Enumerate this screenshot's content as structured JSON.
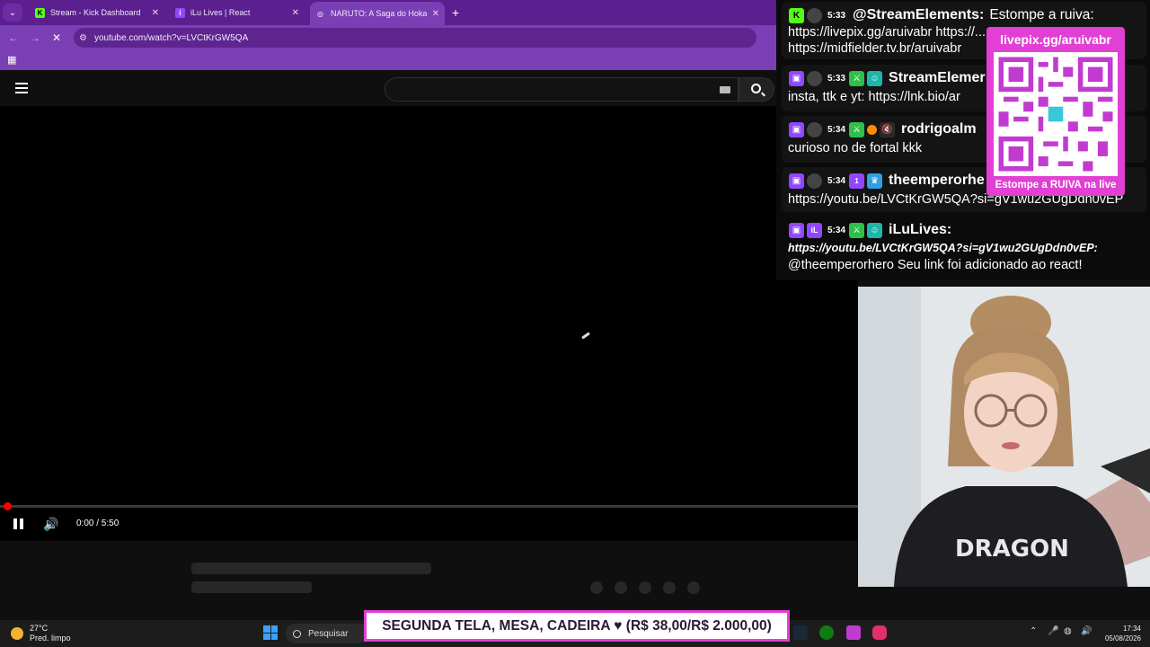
{
  "browser": {
    "tabs": [
      {
        "label": "Stream - Kick Dashboard",
        "favicon": "K",
        "color": "#53fc18"
      },
      {
        "label": "iLu Lives | React",
        "favicon": "i",
        "color": "#9146ff"
      },
      {
        "label": "NARUTO: A Saga do Hokage (I",
        "favicon": "◎",
        "color": "#ffffff"
      }
    ],
    "url": "youtube.com/watch?v=LVCtKrGW5QA"
  },
  "player": {
    "time": "0:00 / 5:50",
    "progress_fraction": 0
  },
  "chat": {
    "messages": [
      {
        "time": "5:33",
        "name": "@StreamElements:",
        "text_inline": "Estompe a ruiva:",
        "line2": "https://livepix.gg/aruivabr https://...",
        "line3": "https://midfielder.tv.br/aruivabr"
      },
      {
        "time": "5:33",
        "name": "StreamElemer",
        "text": "insta, ttk e yt: https://lnk.bio/ar"
      },
      {
        "time": "5:34",
        "name": "rodrigoalm",
        "text": "curioso no de fortal kkk"
      },
      {
        "time": "5:34",
        "name": "theemperorhe",
        "text": "https://youtu.be/LVCtKrGW5QA?si=gV1wu2GUgDdn0vEP"
      },
      {
        "time": "5:34",
        "name": "iLuLives:",
        "link": "https://youtu.be/LVCtKrGW5QA?si=gV1wu2GUgDdn0vEP:",
        "text": "@theemperorhero Seu link foi adicionado ao react!"
      }
    ]
  },
  "qr_overlay": {
    "top": "livepix.gg/aruivabr",
    "bottom": "Estompe a RUIVA na live"
  },
  "banner": {
    "text": "SEGUNDA TELA, MESA, CADEIRA ♥ (R$ 38,00/R$ 2.000,00)"
  },
  "taskbar": {
    "temp": "27°C",
    "weather": "Pred. limpo",
    "search": "Pesquisar",
    "time": "17:34",
    "date": "05/08/2026"
  }
}
